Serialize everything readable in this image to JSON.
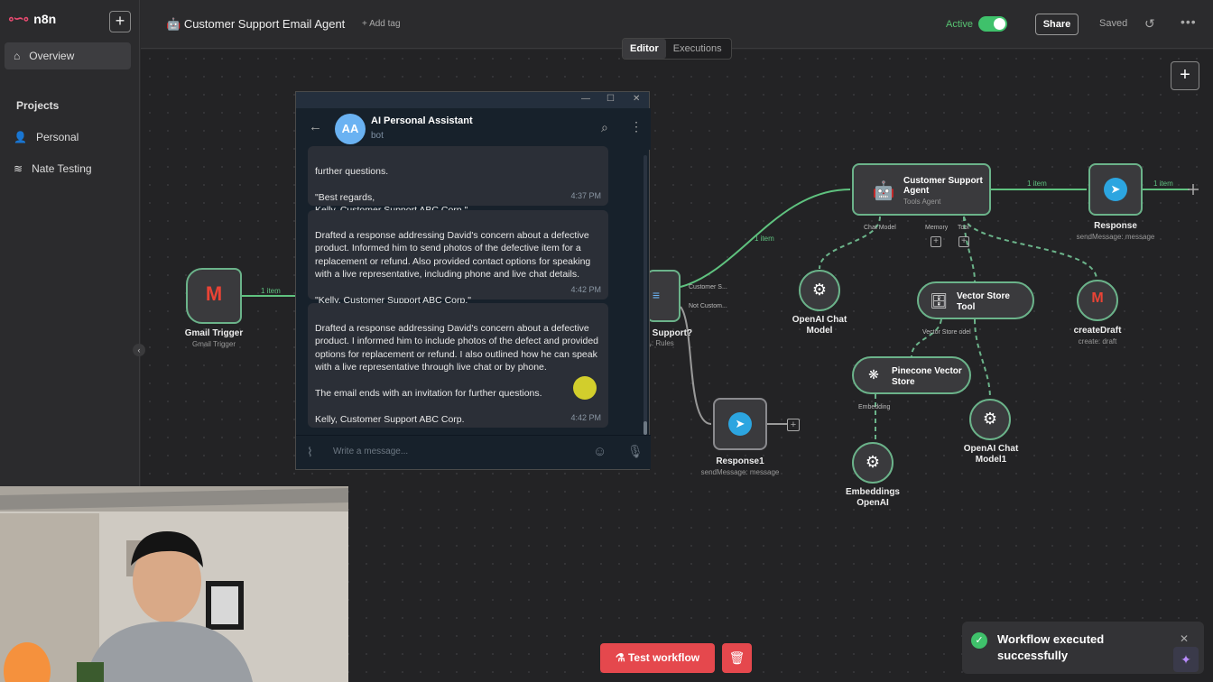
{
  "app": {
    "logo_text": "n8n",
    "new_button": "+"
  },
  "sidebar": {
    "overview": "Overview",
    "projects_label": "Projects",
    "projects": [
      "Personal",
      "Nate Testing"
    ]
  },
  "topbar": {
    "workflow_title": "Customer Support Email Agent",
    "add_tag": "+ Add tag",
    "active_label": "Active",
    "share": "Share",
    "saved": "Saved"
  },
  "tabs": [
    "Editor",
    "Executions"
  ],
  "canvas": {
    "plus": "+",
    "edge_labels": {
      "gmail_to_switch": "1 item",
      "switch_to_agent": "1 item",
      "agent_to_response": "1 item",
      "response_out": "1 item"
    },
    "nodes": {
      "gmail_trigger": {
        "title": "Gmail Trigger",
        "sub": "Gmail Trigger"
      },
      "switch": {
        "title": "r Support?",
        "sub": "ر: Rules",
        "out1": "Customer S...",
        "out2": "Not Custom..."
      },
      "agent": {
        "title": "Customer Support Agent",
        "sub": "Tools Agent",
        "ports": [
          "Chat Model",
          "Memory",
          "Tool"
        ]
      },
      "response": {
        "title": "Response",
        "sub": "sendMessage: message"
      },
      "response1": {
        "title": "Response1",
        "sub": "sendMessage: message"
      },
      "openai_chat": {
        "title": "OpenAI Chat Model"
      },
      "vector_tool": {
        "title": "Vector Store Tool",
        "port": "Vector Store  odel"
      },
      "create_draft": {
        "title": "createDraft",
        "sub": "create: draft"
      },
      "pinecone": {
        "title": "Pinecone Vector Store",
        "port": "Embedding"
      },
      "openai_chat1": {
        "title": "OpenAI Chat Model1"
      },
      "embeddings": {
        "title": "Embeddings OpenAI"
      }
    }
  },
  "chat": {
    "name": "AI Personal Assistant",
    "status": "bot",
    "avatar": "AA",
    "input_placeholder": "Write a message...",
    "messages": [
      {
        "text": "further questions.\n\n\"Best regards,\nKelly, Customer Support ABC Corp.\"",
        "time": "4:37 PM"
      },
      {
        "text": "Drafted a response addressing David's concern about a defective product. Informed him to send photos of the defective item for a replacement or refund. Also provided contact options for speaking with a live representative, including phone and live chat details.\n\n\"Kelly, Customer Support ABC Corp.\"",
        "time": "4:42 PM"
      },
      {
        "text": "Drafted a response addressing David's concern about a defective product. I informed him to include photos of the defect and provided options for replacement or refund. I also outlined how he can speak with a live representative through live chat or by phone.\n\nThe email ends with an invitation for further questions.\n\nKelly, Customer Support ABC Corp.",
        "time": "4:42 PM"
      }
    ]
  },
  "bottom": {
    "test_workflow": "Test workflow"
  },
  "toast": {
    "text": "Workflow executed successfully"
  },
  "colors": {
    "accent_red": "#e5484d",
    "active_green": "#3fc16b",
    "success_border": "#6bb38a",
    "telegram_blue": "#2ca5e0"
  }
}
